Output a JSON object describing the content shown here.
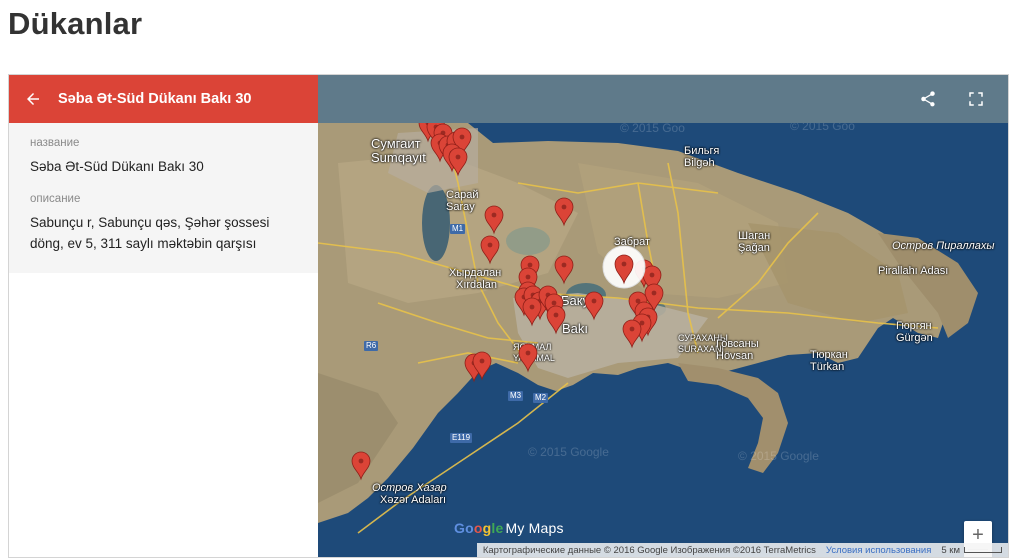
{
  "page": {
    "title": "Dükanlar"
  },
  "panel": {
    "title": "Səba Ət-Süd Dükanı Bakı 30",
    "fields": [
      {
        "label": "название",
        "value": "Səba Ət-Süd Dükanı Bakı 30"
      },
      {
        "label": "описание",
        "value": "Sabunçu r, Sabunçu qəs, Şəhər şossesi döng, ev 5, 311 saylı məktəbin qarşısı"
      }
    ]
  },
  "toolbar": {
    "share_icon": "share-icon",
    "fullscreen_icon": "fullscreen-icon"
  },
  "map": {
    "labels": {
      "sumgait_ru": "Сумгаит",
      "sumgait_az": "Sumqayıt",
      "bilgah_ru": "Бильгя",
      "bilgah_az": "Bilgəh",
      "saray_ru": "Сарай",
      "saray_az": "Saray",
      "zabrat_ru": "Забрат",
      "shagan_ru": "Шаган",
      "shagan_az": "Şağan",
      "pirallahi_ru": "Остров Пираллахы",
      "pirallahi_az": "Pirallahı Adası",
      "khirdalan_ru": "Хырдалан",
      "khirdalan_az": "Xırdalan",
      "baku_ru": "Баку",
      "baku_az": "Bakı",
      "yasamal_ru": "ЯСАМАЛ",
      "yasamal_az": "YASAMAL",
      "surakhani_ru": "СУРАХАНЫ",
      "surakhani_az": "SURAXANI",
      "hovsan_ru": "Говсаны",
      "hovsan_az": "Hövsan",
      "turkan_ru": "Тюркан",
      "turkan_az": "Türkan",
      "gurgan_ru": "Гюргян",
      "gurgan_az": "Gürgən",
      "khazar_ru": "Остров Хазар",
      "khazar_az": "Xəzər Adaları"
    },
    "highways": [
      "M1",
      "R6",
      "M3",
      "M2",
      "E119"
    ],
    "watermark": "© 2015 Goo",
    "watermark_full": "© 2015 Google",
    "zoom_in": "+",
    "zoom_out": "−",
    "logo": {
      "g1": "Go",
      "g2": "o",
      "g3": "g",
      "g4": "le",
      "my_maps": "My Maps"
    },
    "attribution": "Картографические данные © 2016 Google Изображения ©2016 TerraMetrics",
    "terms": "Условия использования",
    "scale": "5 км",
    "colors": {
      "header": "#db4437",
      "toolbar": "#5f7a8a",
      "marker": "#db4437",
      "water": "#1e4a79",
      "land": "#a99a78"
    }
  }
}
